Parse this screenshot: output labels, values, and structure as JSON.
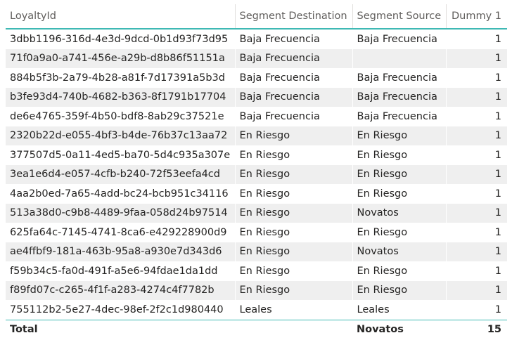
{
  "table": {
    "columns": [
      "LoyaltyId",
      "Segment Destination",
      "Segment Source",
      "Dummy 1"
    ],
    "rows": [
      [
        "3dbb1196-316d-4e3d-9dcd-0b1d93f73d95",
        "Baja Frecuencia",
        "Baja Frecuencia",
        "1"
      ],
      [
        "71f0a9a0-a741-456e-a29b-d8b86f51151a",
        "Baja Frecuencia",
        "",
        "1"
      ],
      [
        "884b5f3b-2a79-4b28-a81f-7d17391a5b3d",
        "Baja Frecuencia",
        "Baja Frecuencia",
        "1"
      ],
      [
        "b3fe93d4-740b-4682-b363-8f1791b17704",
        "Baja Frecuencia",
        "Baja Frecuencia",
        "1"
      ],
      [
        "de6e4765-359f-4b50-bdf8-8ab29c37521e",
        "Baja Frecuencia",
        "Baja Frecuencia",
        "1"
      ],
      [
        "2320b22d-e055-4bf3-b4de-76b37c13aa72",
        "En Riesgo",
        "En Riesgo",
        "1"
      ],
      [
        "377507d5-0a11-4ed5-ba70-5d4c935a307e",
        "En Riesgo",
        "En Riesgo",
        "1"
      ],
      [
        "3ea1e6d4-e057-4cfb-b240-72f53eefa4cd",
        "En Riesgo",
        "En Riesgo",
        "1"
      ],
      [
        "4aa2b0ed-7a65-4add-bc24-bcb951c34116",
        "En Riesgo",
        "En Riesgo",
        "1"
      ],
      [
        "513a38d0-c9b8-4489-9faa-058d24b97514",
        "En Riesgo",
        "Novatos",
        "1"
      ],
      [
        "625fa64c-7145-4741-8ca6-e429228900d9",
        "En Riesgo",
        "En Riesgo",
        "1"
      ],
      [
        "ae4ffbf9-181a-463b-95a8-a930e7d343d6",
        "En Riesgo",
        "Novatos",
        "1"
      ],
      [
        "f59b34c5-fa0d-491f-a5e6-94fdae1da1dd",
        "En Riesgo",
        "En Riesgo",
        "1"
      ],
      [
        "f89fd07c-c265-4f1f-a283-4274c4f7782b",
        "En Riesgo",
        "En Riesgo",
        "1"
      ],
      [
        "755112b2-5e27-4dec-98ef-2f2c1d980440",
        "Leales",
        "Leales",
        "1"
      ]
    ],
    "total": {
      "label": "Total",
      "destination": "",
      "source": "Novatos",
      "dummy": "15"
    }
  },
  "colors": {
    "accent": "#3fb9b4",
    "row_alt": "#efefef",
    "header_text": "#605e5c",
    "body_text": "#252423"
  }
}
